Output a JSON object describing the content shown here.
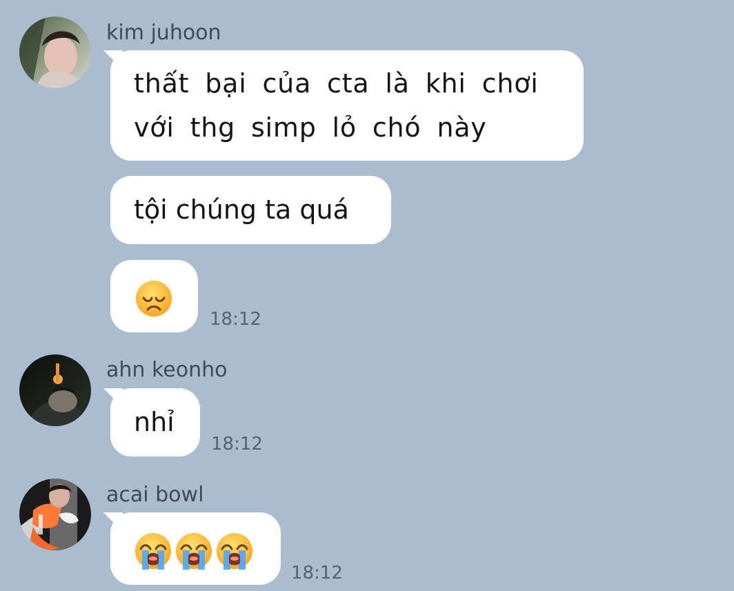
{
  "colors": {
    "background": "#aabccf",
    "bubble": "#ffffff",
    "text": "#141414",
    "meta": "#556270"
  },
  "messages": [
    {
      "sender": "kim juhoon",
      "avatar_icon": "profile-photo-icon",
      "bubbles": [
        "thất bại của cta là khi chơi với thg simp lỏ chó này",
        "tội chúng ta quá",
        "😞"
      ],
      "time": "18:12"
    },
    {
      "sender": "ahn keonho",
      "avatar_icon": "profile-photo-icon",
      "bubbles": [
        "nhỉ"
      ],
      "time": "18:12"
    },
    {
      "sender": "acai bowl",
      "avatar_icon": "profile-photo-icon",
      "bubbles": [
        "😭😭😭"
      ],
      "time": "18:12"
    }
  ]
}
